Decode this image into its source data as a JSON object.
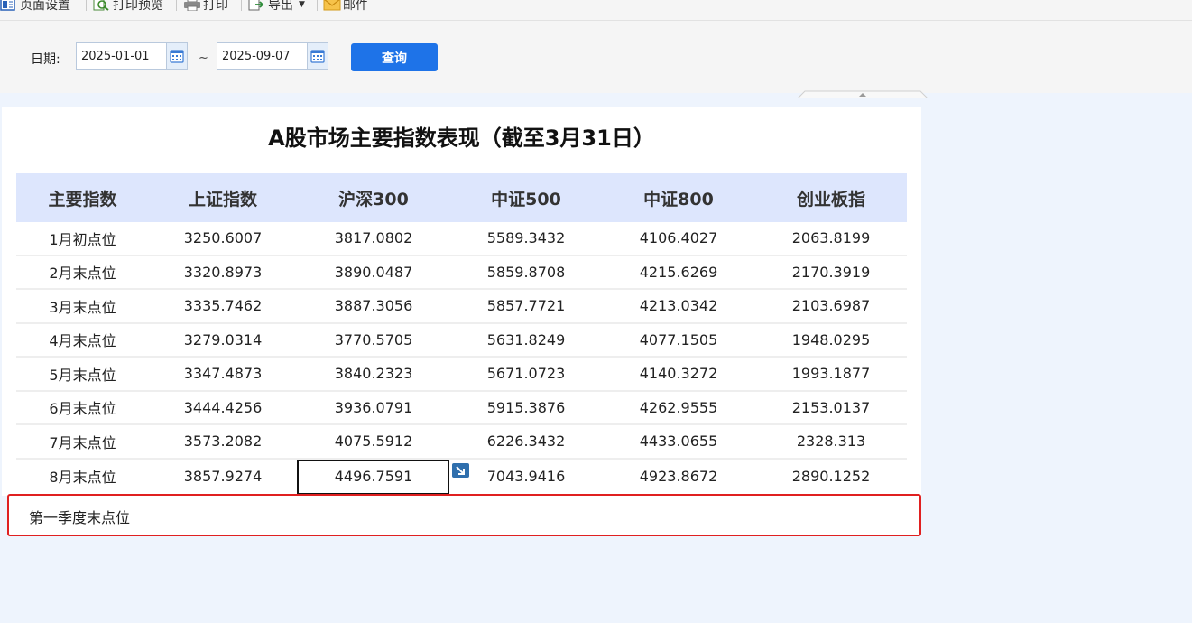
{
  "toolbar": {
    "page_setup": "页面设置",
    "print_preview": "打印预览",
    "print": "打印",
    "export": "导出",
    "mail": "邮件"
  },
  "filter": {
    "date_label": "日期:",
    "start_date": "2025-01-01",
    "end_date": "2025-09-07",
    "separator": "~",
    "query_button": "查询"
  },
  "report": {
    "title": "A股市场主要指数表现（截至3月31日）",
    "columns": [
      "主要指数",
      "上证指数",
      "沪深300",
      "中证500",
      "中证800",
      "创业板指"
    ],
    "rows": [
      [
        "1月初点位",
        "3250.6007",
        "3817.0802",
        "5589.3432",
        "4106.4027",
        "2063.8199"
      ],
      [
        "2月末点位",
        "3320.8973",
        "3890.0487",
        "5859.8708",
        "4215.6269",
        "2170.3919"
      ],
      [
        "3月末点位",
        "3335.7462",
        "3887.3056",
        "5857.7721",
        "4213.0342",
        "2103.6987"
      ],
      [
        "4月末点位",
        "3279.0314",
        "3770.5705",
        "5631.8249",
        "4077.1505",
        "1948.0295"
      ],
      [
        "5月末点位",
        "3347.4873",
        "3840.2323",
        "5671.0723",
        "4140.3272",
        "1993.1877"
      ],
      [
        "6月末点位",
        "3444.4256",
        "3936.0791",
        "5915.3876",
        "4262.9555",
        "2153.0137"
      ],
      [
        "7月末点位",
        "3573.2082",
        "4075.5912",
        "6226.3432",
        "4433.0655",
        "2328.313"
      ],
      [
        "8月末点位",
        "3857.9274",
        "4496.7591",
        "7043.9416",
        "4923.8672",
        "2890.1252"
      ]
    ],
    "selected_cell": "4496.7591",
    "footnote_row": "第一季度末点位"
  },
  "colors": {
    "accent": "#1e73e8",
    "header_bg": "#dde6fd",
    "highlight_border": "#e02020",
    "page_bg": "#eef4fd"
  },
  "icons": [
    "page-setup-icon",
    "print-preview-icon",
    "printer-icon",
    "export-icon",
    "mail-icon",
    "calendar-icon",
    "expand-icon"
  ]
}
